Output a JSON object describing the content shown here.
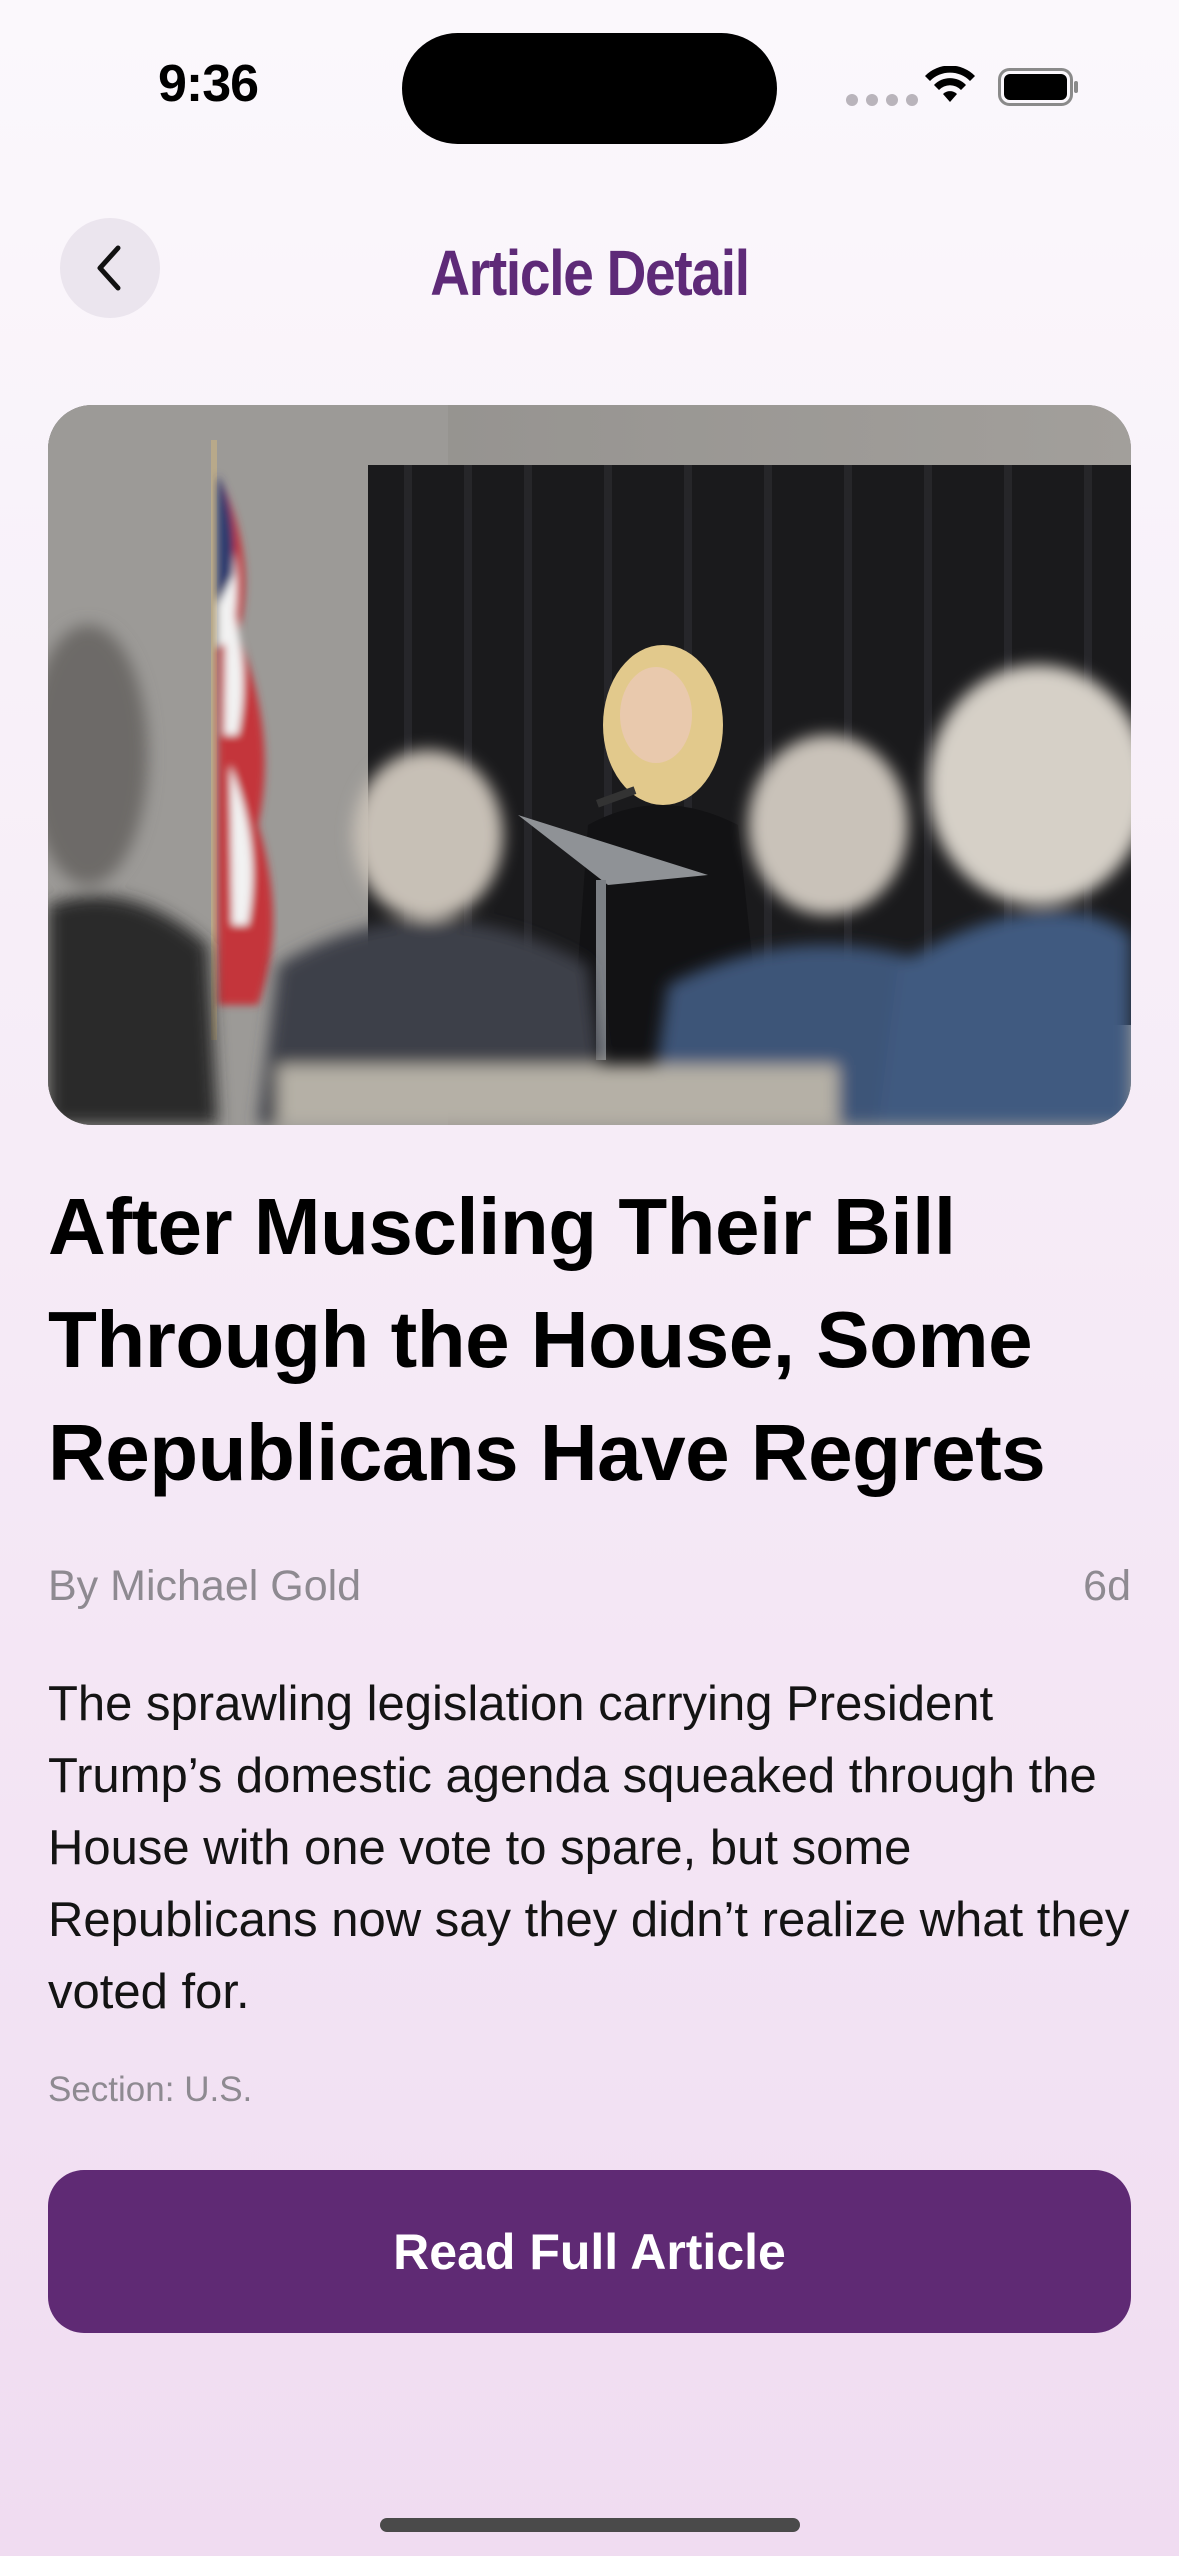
{
  "status_bar": {
    "time": "9:36"
  },
  "nav": {
    "title": "Article Detail",
    "back_icon": "chevron-left-icon"
  },
  "hero": {
    "image_description": ""
  },
  "article": {
    "headline": "After Muscling Their Bill Through the House, Some Republicans Have Regrets",
    "byline": "By Michael Gold",
    "age": "6d",
    "summary": "The sprawling legislation carrying President Trump’s domestic agenda squeaked through the House with one vote to spare, but some Republicans now say they didn’t realize what they voted for.",
    "section": "Section: U.S."
  },
  "actions": {
    "read_full_label": "Read Full Article"
  },
  "colors": {
    "accent": "#5f2a74",
    "title": "#5e2a78",
    "muted": "#8e8a91"
  }
}
